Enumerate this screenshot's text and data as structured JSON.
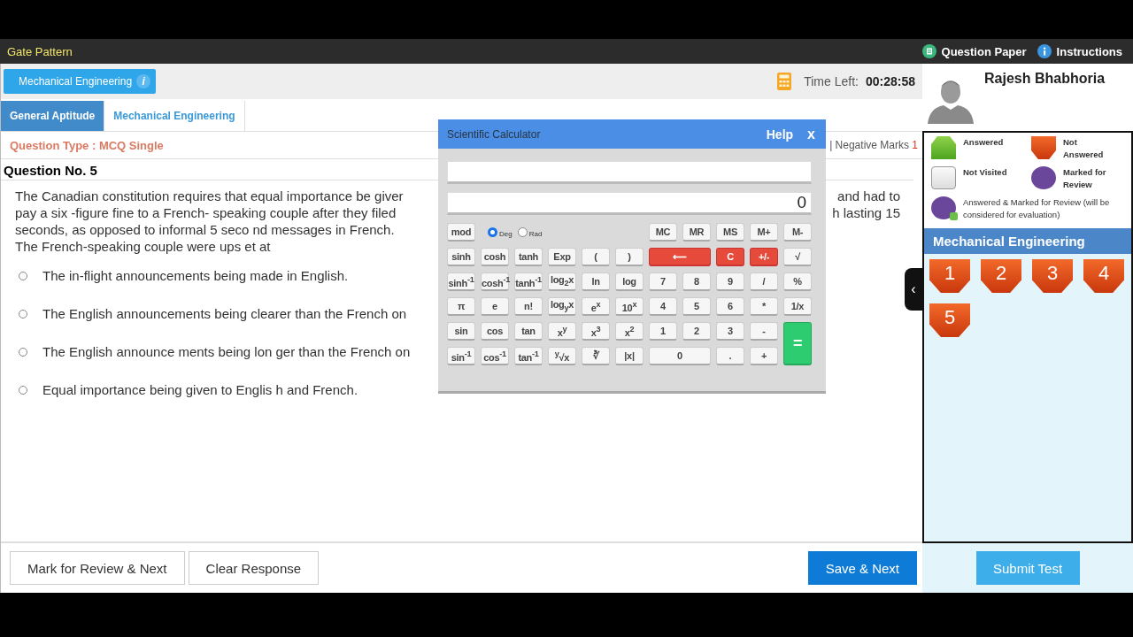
{
  "header": {
    "title": "Gate Pattern",
    "links": [
      {
        "label": "Question Paper",
        "kind": "paper"
      },
      {
        "label": "Instructions",
        "kind": "info"
      }
    ]
  },
  "section_button": {
    "label": "Mechanical Engineering",
    "info": "i"
  },
  "timer": {
    "label": "Time Left:",
    "value": "00:28:58"
  },
  "tabs": [
    {
      "label": "General Aptitude",
      "selected": true
    },
    {
      "label": "Mechanical Engineering",
      "selected": false
    }
  ],
  "question_type": {
    "label": "Question Type : MCQ Single",
    "negative_label": "| Negative Marks",
    "negative_value": "1"
  },
  "question": {
    "number": "Question No. 5",
    "lines": [
      {
        "left": "The Canadian constitution requires that equal importance be giver",
        "right": "and had to"
      },
      {
        "left": "pay a six -figure fine to a French- speaking couple after they filed",
        "right": "h lasting 15"
      },
      {
        "left": "seconds, as opposed to informal 5 seco nd messages in French."
      },
      {
        "left": "The French-speaking couple were ups et at"
      }
    ],
    "options": [
      {
        "text": "The in-flight announcements being made in English.",
        "selected": false
      },
      {
        "text": "The English announcements being clearer than the French on",
        "selected": false
      },
      {
        "text": "The English announce ments being lon ger than the French on",
        "selected": false
      },
      {
        "text": "Equal importance being given to Englis h and French.",
        "selected": false
      }
    ]
  },
  "actions": [
    {
      "label": "Mark for Review & Next",
      "kind": "plain"
    },
    {
      "label": "Clear Response",
      "kind": "plain"
    },
    {
      "label": "Save & Next",
      "kind": "primary"
    }
  ],
  "collapse_handle": "‹",
  "calculator": {
    "title": "Scientific Calculator",
    "help": "Help",
    "close": "x",
    "display_value": "0",
    "mod": "mod",
    "angle_modes": [
      {
        "label": "Deg",
        "selected": true
      },
      {
        "label": "Rad",
        "selected": false
      }
    ],
    "memory_keys": [
      "MC",
      "MR",
      "MS",
      "M+",
      "M-"
    ],
    "keys": [
      {
        "label": "sinh",
        "kind": "key"
      },
      {
        "label": "cosh",
        "kind": "key"
      },
      {
        "label": "tanh",
        "kind": "key"
      },
      {
        "label": "Exp",
        "kind": "key"
      },
      {
        "label": "(",
        "kind": "key"
      },
      {
        "label": ")",
        "kind": "key"
      },
      {
        "label": "⟵",
        "kind": "red",
        "wide": true
      },
      {
        "label": "C",
        "kind": "red"
      },
      {
        "label": "+/-",
        "kind": "red"
      },
      {
        "label": "√",
        "kind": "key"
      },
      {
        "label": "sinh$^{-1}$",
        "kind": "key"
      },
      {
        "label": "cosh$^{-1}$",
        "kind": "key"
      },
      {
        "label": "tanh$^{-1}$",
        "kind": "key"
      },
      {
        "label": "log$_{2}$x",
        "kind": "key"
      },
      {
        "label": "ln",
        "kind": "key"
      },
      {
        "label": "log",
        "kind": "key"
      },
      {
        "label": "7",
        "kind": "key"
      },
      {
        "label": "8",
        "kind": "key"
      },
      {
        "label": "9",
        "kind": "key"
      },
      {
        "label": "/",
        "kind": "key"
      },
      {
        "label": "%",
        "kind": "key"
      },
      {
        "label": "π",
        "kind": "key"
      },
      {
        "label": "e",
        "kind": "key"
      },
      {
        "label": "n!",
        "kind": "key"
      },
      {
        "label": "log$_{y}$x",
        "kind": "key"
      },
      {
        "label": "e$^{x}$",
        "kind": "key"
      },
      {
        "label": "10$^{x}$",
        "kind": "key"
      },
      {
        "label": "4",
        "kind": "key"
      },
      {
        "label": "5",
        "kind": "key"
      },
      {
        "label": "6",
        "kind": "key"
      },
      {
        "label": "*",
        "kind": "key"
      },
      {
        "label": "1/x",
        "kind": "key"
      },
      {
        "label": "sin",
        "kind": "key"
      },
      {
        "label": "cos",
        "kind": "key"
      },
      {
        "label": "tan",
        "kind": "key"
      },
      {
        "label": "x$^{y}$",
        "kind": "key"
      },
      {
        "label": "x$^{3}$",
        "kind": "key"
      },
      {
        "label": "x$^{2}$",
        "kind": "key"
      },
      {
        "label": "1",
        "kind": "key"
      },
      {
        "label": "2",
        "kind": "key"
      },
      {
        "label": "3",
        "kind": "key"
      },
      {
        "label": "-",
        "kind": "key"
      },
      {
        "label": "=",
        "kind": "green",
        "tall": true
      },
      {
        "label": "sin$^{-1}$",
        "kind": "key"
      },
      {
        "label": "cos$^{-1}$",
        "kind": "key"
      },
      {
        "label": "tan$^{-1}$",
        "kind": "key"
      },
      {
        "label": "$^{y}$√x",
        "kind": "key"
      },
      {
        "label": "∛",
        "kind": "key"
      },
      {
        "label": "|x|",
        "kind": "key"
      },
      {
        "label": "0",
        "kind": "key",
        "wide": true
      },
      {
        "label": ".",
        "kind": "key"
      },
      {
        "label": "+",
        "kind": "key"
      }
    ]
  },
  "candidate": {
    "name": "Rajesh Bhabhoria"
  },
  "legend": [
    {
      "label": "Answered",
      "kind": "answered"
    },
    {
      "label": "Not Answered",
      "kind": "not_answered"
    },
    {
      "label": "Not Visited",
      "kind": "not_visited"
    },
    {
      "label": "Marked for Review",
      "kind": "marked"
    },
    {
      "label": "Answered & Marked for Review (will be considered for evaluation)",
      "kind": "answered_marked"
    }
  ],
  "palette": {
    "title": "Mechanical Engineering",
    "questions": [
      {
        "number": "1",
        "kind": "not_answered"
      },
      {
        "number": "2",
        "kind": "not_answered"
      },
      {
        "number": "3",
        "kind": "not_answered"
      },
      {
        "number": "4",
        "kind": "not_answered"
      },
      {
        "number": "5",
        "kind": "not_answered"
      }
    ]
  },
  "submit": {
    "label": "Submit Test"
  }
}
